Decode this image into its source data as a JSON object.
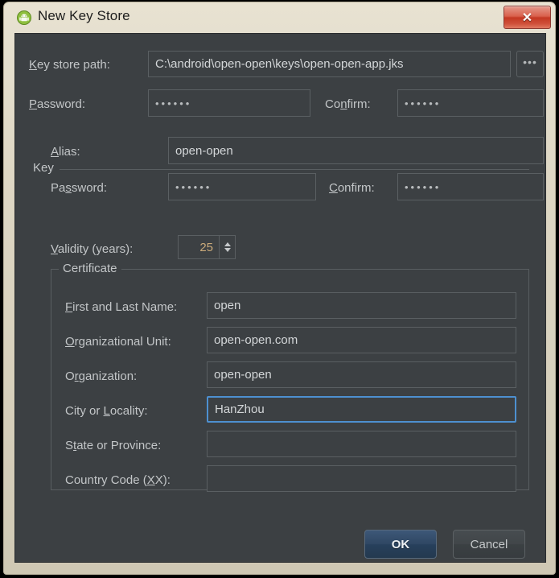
{
  "window": {
    "title": "New Key Store",
    "icon": "android-robot-icon",
    "close_label": "✕",
    "frame_color": "#ded7c4",
    "content_bg": "#3c4043",
    "accent_focus": "#4d90d0"
  },
  "keystore": {
    "path_label_pre": "",
    "path_label_mnemonic": "K",
    "path_label_post": "ey store path:",
    "path_value": "C:\\android\\open-open\\keys\\open-open-app.jks",
    "browse_label": "•••",
    "password_label_pre": "",
    "password_label_mnemonic": "P",
    "password_label_post": "assword:",
    "password_value": "••••••",
    "confirm_label_pre": "Co",
    "confirm_label_mnemonic": "n",
    "confirm_label_post": "firm:",
    "confirm_value": "••••••"
  },
  "key_group": {
    "title": "Key",
    "alias_label_pre": "",
    "alias_label_mnemonic": "A",
    "alias_label_post": "lias:",
    "alias_value": "open-open",
    "password_label_pre": "Pa",
    "password_label_mnemonic": "s",
    "password_label_post": "sword:",
    "password_value": "••••••",
    "confirm_label_pre": "",
    "confirm_label_mnemonic": "C",
    "confirm_label_post": "onfirm:",
    "confirm_value": "••••••",
    "validity_label_pre": "",
    "validity_label_mnemonic": "V",
    "validity_label_post": "alidity (years):",
    "validity_value": "25"
  },
  "certificate": {
    "title": "Certificate",
    "fields": [
      {
        "label_pre": "",
        "label_mnemonic": "F",
        "label_post": "irst and Last Name:",
        "value": "open",
        "focused": false,
        "name": "first-and-last-name"
      },
      {
        "label_pre": "",
        "label_mnemonic": "O",
        "label_post": "rganizational Unit:",
        "value": "open-open.com",
        "focused": false,
        "name": "organizational-unit"
      },
      {
        "label_pre": "O",
        "label_mnemonic": "r",
        "label_post": "ganization:",
        "value": "open-open",
        "focused": false,
        "name": "organization"
      },
      {
        "label_pre": "City or ",
        "label_mnemonic": "L",
        "label_post": "ocality:",
        "value": "HanZhou",
        "focused": true,
        "name": "city-or-locality"
      },
      {
        "label_pre": "S",
        "label_mnemonic": "t",
        "label_post": "ate or Province:",
        "value": "",
        "focused": false,
        "name": "state-or-province"
      },
      {
        "label_pre": "Country Code (",
        "label_mnemonic": "X",
        "label_post": "X):",
        "value": "",
        "focused": false,
        "name": "country-code"
      }
    ]
  },
  "footer": {
    "ok_label": "OK",
    "cancel_label": "Cancel"
  }
}
